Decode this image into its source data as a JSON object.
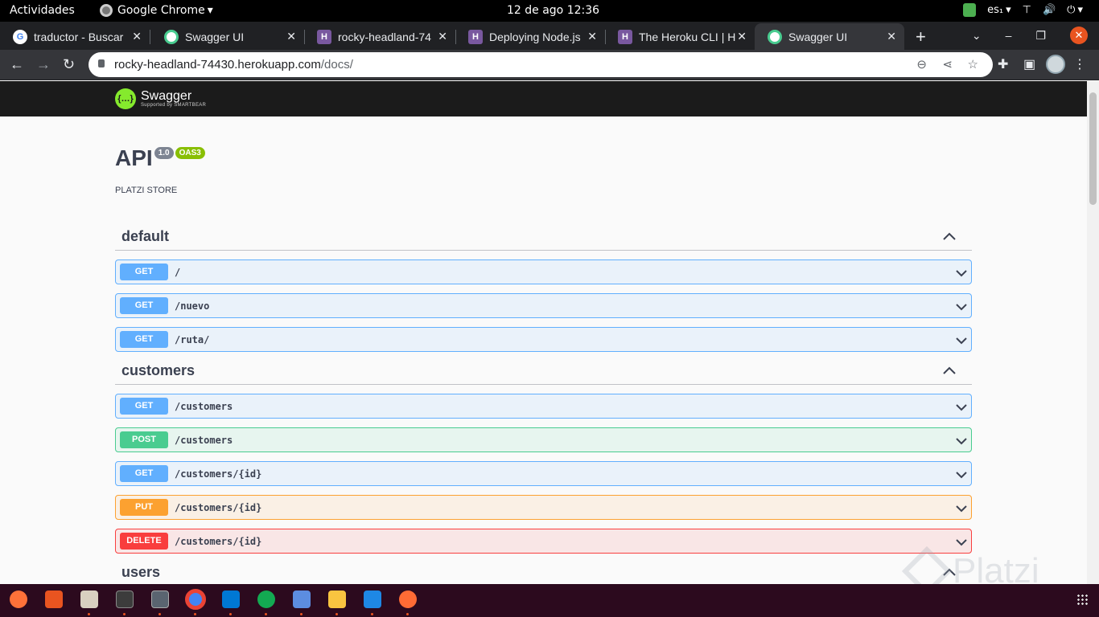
{
  "system": {
    "activities": "Actividades",
    "app_name": "Google Chrome",
    "clock": "12 de ago  12:36",
    "keyboard": "es₁"
  },
  "tabs": [
    {
      "title": "traductor - Buscar",
      "favicon": "google-icon"
    },
    {
      "title": "Swagger UI",
      "favicon": "swagger-icon"
    },
    {
      "title": "rocky-headland-74",
      "favicon": "heroku-icon"
    },
    {
      "title": "Deploying Node.js",
      "favicon": "heroku-icon"
    },
    {
      "title": "The Heroku CLI | H",
      "favicon": "heroku-icon"
    },
    {
      "title": "Swagger UI",
      "favicon": "swagger-icon",
      "active": true
    }
  ],
  "address": {
    "host": "rocky-headland-74430.herokuapp.com",
    "path": "/docs/"
  },
  "swagger": {
    "brand": "Swagger",
    "brand_sub": "Supported by SMARTBEAR"
  },
  "info": {
    "title": "API",
    "version": "1.0",
    "oas": "OAS3",
    "description": "PLATZI STORE"
  },
  "sections": [
    {
      "name": "default",
      "ops": [
        {
          "method": "GET",
          "path": "/"
        },
        {
          "method": "GET",
          "path": "/nuevo"
        },
        {
          "method": "GET",
          "path": "/ruta/"
        }
      ]
    },
    {
      "name": "customers",
      "ops": [
        {
          "method": "GET",
          "path": "/customers"
        },
        {
          "method": "POST",
          "path": "/customers"
        },
        {
          "method": "GET",
          "path": "/customers/{id}"
        },
        {
          "method": "PUT",
          "path": "/customers/{id}"
        },
        {
          "method": "DELETE",
          "path": "/customers/{id}"
        }
      ]
    },
    {
      "name": "users",
      "ops": []
    }
  ],
  "watermark": "Platzi",
  "colors": {
    "get": "#61affe",
    "post": "#49cc90",
    "put": "#fca130",
    "delete": "#f93e3e"
  }
}
